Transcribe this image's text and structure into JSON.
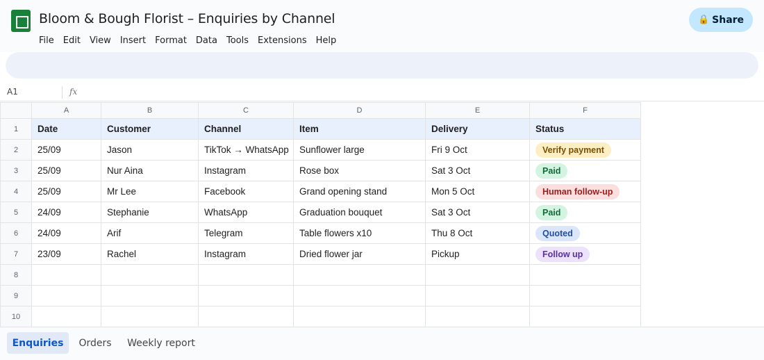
{
  "header": {
    "title": "Bloom & Bough Florist – Enquiries by Channel",
    "share_label": "Share",
    "menu": [
      "File",
      "Edit",
      "View",
      "Insert",
      "Format",
      "Data",
      "Tools",
      "Extensions",
      "Help"
    ]
  },
  "formula_bar": {
    "cell_ref": "A1",
    "fx_label": "fx"
  },
  "grid": {
    "column_letters": [
      "A",
      "B",
      "C",
      "D",
      "E",
      "F"
    ],
    "row_numbers": [
      "1",
      "2",
      "3",
      "4",
      "5",
      "6",
      "7",
      "8",
      "9",
      "10"
    ],
    "headers": [
      "Date",
      "Customer",
      "Channel",
      "Item",
      "Delivery",
      "Status"
    ],
    "rows": [
      {
        "date": "25/09",
        "customer": "Jason",
        "channel": "TikTok → WhatsApp",
        "item": "Sunflower large",
        "delivery": "Fri 9 Oct",
        "status": "Verify payment"
      },
      {
        "date": "25/09",
        "customer": "Nur Aina",
        "channel": "Instagram",
        "item": "Rose box",
        "delivery": "Sat 3 Oct",
        "status": "Paid"
      },
      {
        "date": "25/09",
        "customer": "Mr Lee",
        "channel": "Facebook",
        "item": "Grand opening stand",
        "delivery": "Mon 5 Oct",
        "status": "Human follow-up"
      },
      {
        "date": "24/09",
        "customer": "Stephanie",
        "channel": "WhatsApp",
        "item": "Graduation bouquet",
        "delivery": "Sat 3 Oct",
        "status": "Paid"
      },
      {
        "date": "24/09",
        "customer": "Arif",
        "channel": "Telegram",
        "item": "Table flowers x10",
        "delivery": "Thu 8 Oct",
        "status": "Quoted"
      },
      {
        "date": "23/09",
        "customer": "Rachel",
        "channel": "Instagram",
        "item": "Dried flower jar",
        "delivery": "Pickup",
        "status": "Follow up"
      }
    ]
  },
  "status_colors": {
    "Verify payment": {
      "bg": "#fdefc3",
      "fg": "#7a4f01"
    },
    "Paid": {
      "bg": "#d4f4e2",
      "fg": "#0d6b3a"
    },
    "Human follow-up": {
      "bg": "#fcdede",
      "fg": "#9b1c1c"
    },
    "Quoted": {
      "bg": "#dbe6fb",
      "fg": "#1f4fa3"
    },
    "Follow up": {
      "bg": "#ece2fb",
      "fg": "#5b2ea6"
    }
  },
  "sheet_tabs": [
    "Enquiries",
    "Orders",
    "Weekly report"
  ],
  "icons": {
    "share": "lock-icon",
    "logo": "sheets-logo-icon"
  }
}
